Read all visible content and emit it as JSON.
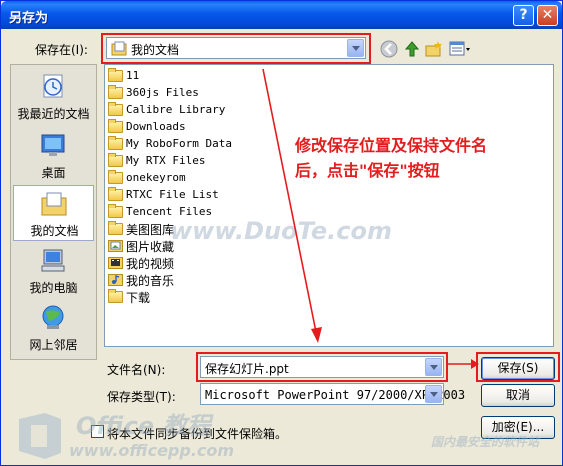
{
  "window": {
    "title": "另存为",
    "help": "?",
    "close": "✕"
  },
  "save_in": {
    "label": "保存在(I):",
    "value": "我的文档"
  },
  "places": [
    {
      "label": "我最近的文档",
      "icon": "recent-documents-icon"
    },
    {
      "label": "桌面",
      "icon": "desktop-icon"
    },
    {
      "label": "我的文档",
      "icon": "my-documents-icon",
      "selected": true
    },
    {
      "label": "我的电脑",
      "icon": "my-computer-icon"
    },
    {
      "label": "网上邻居",
      "icon": "network-places-icon"
    }
  ],
  "files": [
    {
      "name": "11",
      "type": "folder"
    },
    {
      "name": "360js Files",
      "type": "folder"
    },
    {
      "name": "Calibre Library",
      "type": "folder"
    },
    {
      "name": "Downloads",
      "type": "folder"
    },
    {
      "name": "My RoboForm Data",
      "type": "folder"
    },
    {
      "name": "My RTX Files",
      "type": "folder"
    },
    {
      "name": "onekeyrom",
      "type": "folder"
    },
    {
      "name": "RTXC File List",
      "type": "folder"
    },
    {
      "name": "Tencent Files",
      "type": "folder"
    },
    {
      "name": "美图图库",
      "type": "folder"
    },
    {
      "name": "图片收藏",
      "type": "special"
    },
    {
      "name": "我的视频",
      "type": "special"
    },
    {
      "name": "我的音乐",
      "type": "special"
    },
    {
      "name": "下载",
      "type": "folder"
    }
  ],
  "filename": {
    "label": "文件名(N):",
    "value": "保存幻灯片.ppt"
  },
  "filetype": {
    "label": "保存类型(T):",
    "value": "Microsoft PowerPoint 97/2000/XP/2003"
  },
  "buttons": {
    "save": "保存(S)",
    "cancel": "取消",
    "encrypt": "加密(E)..."
  },
  "checkbox": {
    "label": "将本文件同步备份到文件保险箱。"
  },
  "annotation": "修改保存位置及保持文件名后，点击\"保存\"按钮",
  "watermarks": {
    "site": "www.DuoTe.com",
    "brand": "Office 教程",
    "url": "www.officepp.com",
    "vendor": "国内最安全的软件站"
  },
  "colors": {
    "annotation_red": "#E31D1D",
    "titlebar_blue": "#0658E9"
  }
}
